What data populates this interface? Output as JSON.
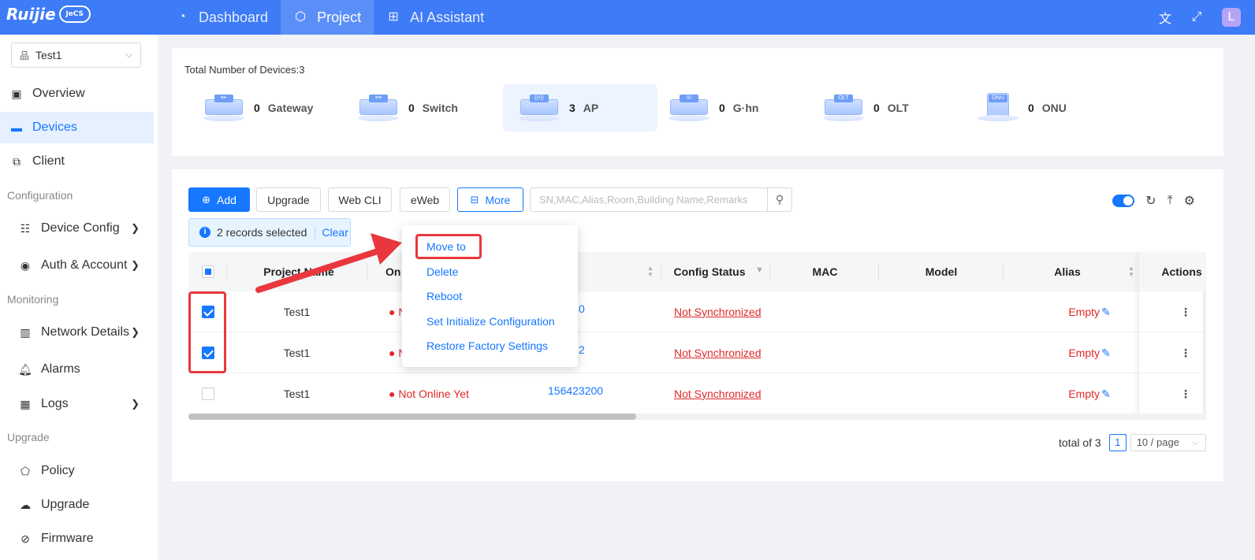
{
  "app": {
    "logo_text": "Ruijie",
    "logo_badge": "JeCS",
    "nav": [
      {
        "label": "Dashboard",
        "icon": "dashboard-icon"
      },
      {
        "label": "Project",
        "icon": "cube-icon"
      },
      {
        "label": "AI Assistant",
        "icon": "grid-icon"
      }
    ],
    "active_nav": "Project",
    "avatar_initial": "L",
    "accent_color": "#3e7bf6"
  },
  "sidebar": {
    "project_selected": "Test1",
    "items": [
      {
        "label": "Overview",
        "icon": "overview-icon"
      },
      {
        "label": "Devices",
        "icon": "devices-icon",
        "active": true
      },
      {
        "label": "Client",
        "icon": "client-icon"
      }
    ],
    "groups": [
      {
        "label": "Configuration",
        "items": [
          {
            "label": "Device Config",
            "icon": "sliders-icon",
            "has_children": true
          },
          {
            "label": "Auth & Account",
            "icon": "user-circle-icon",
            "has_children": true
          }
        ]
      },
      {
        "label": "Monitoring",
        "items": [
          {
            "label": "Network Details",
            "icon": "bar-chart-icon",
            "has_children": true
          },
          {
            "label": "Alarms",
            "icon": "bell-icon"
          },
          {
            "label": "Logs",
            "icon": "calendar-icon",
            "has_children": true
          }
        ]
      },
      {
        "label": "Upgrade",
        "items": [
          {
            "label": "Policy",
            "icon": "policy-icon"
          },
          {
            "label": "Upgrade",
            "icon": "cloud-upload-icon"
          },
          {
            "label": "Firmware",
            "icon": "firmware-icon"
          }
        ]
      }
    ]
  },
  "summary": {
    "total_label": "Total Number of Devices:3",
    "devices": [
      {
        "count": "0",
        "name": "Gateway",
        "tag": "≡•-"
      },
      {
        "count": "0",
        "name": "Switch",
        "tag": "≡≡"
      },
      {
        "count": "3",
        "name": "AP",
        "tag": "((•))",
        "active": true
      },
      {
        "count": "0",
        "name": "G·hn",
        "tag": "☏"
      },
      {
        "count": "0",
        "name": "OLT",
        "tag": "OLT"
      },
      {
        "count": "0",
        "name": "ONU",
        "tag": "ONU"
      }
    ]
  },
  "toolbar": {
    "add": "Add",
    "upgrade": "Upgrade",
    "web_cli": "Web CLI",
    "eweb": "eWeb",
    "more": "More",
    "search_placeholder": "SN,MAC,Alias,Room,Building Name,Remarks"
  },
  "selection": {
    "text": "2 records selected",
    "clear": "Clear"
  },
  "table": {
    "columns": [
      "Project Name",
      "On",
      "Config Status",
      "MAC",
      "Model",
      "Alias",
      "Actions"
    ],
    "rows": [
      {
        "checked": true,
        "project": "Test1",
        "status": "N",
        "sn": "0",
        "config": "Not Synchronized",
        "mac": "",
        "model": "",
        "alias": "Empty"
      },
      {
        "checked": true,
        "project": "Test1",
        "status": "N",
        "sn": "2",
        "config": "Not Synchronized",
        "mac": "",
        "model": "",
        "alias": "Empty"
      },
      {
        "checked": false,
        "project": "Test1",
        "status": "Not Online Yet",
        "sn": "156423200",
        "config": "Not Synchronized",
        "mac": "",
        "model": "",
        "alias": "Empty"
      }
    ]
  },
  "pagination": {
    "total": "total of 3",
    "page": "1",
    "page_size": "10 / page"
  },
  "more_menu": {
    "items": [
      "Move to",
      "Delete",
      "Reboot",
      "Set Initialize Configuration",
      "Restore Factory Settings"
    ],
    "highlighted": "Move to"
  },
  "annotation_color": "#e8383d"
}
